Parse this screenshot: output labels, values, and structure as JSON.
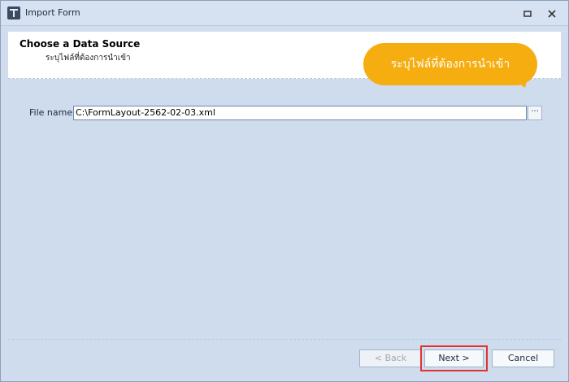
{
  "window": {
    "title": "Import Form"
  },
  "header": {
    "title": "Choose a Data Source",
    "subtitle": "ระบุไฟล์ที่ต้องการนำเข้า"
  },
  "callout": {
    "text": "ระบุไฟล์ที่ต้องการนำเข้า",
    "color": "#f5ad10"
  },
  "form": {
    "file_label": "File name",
    "file_value": "C:\\FormLayout-2562-02-03.xml",
    "browse_label": "···"
  },
  "buttons": {
    "back": "< Back",
    "next": "Next >",
    "cancel": "Cancel"
  },
  "colors": {
    "highlight": "#e0342f"
  }
}
